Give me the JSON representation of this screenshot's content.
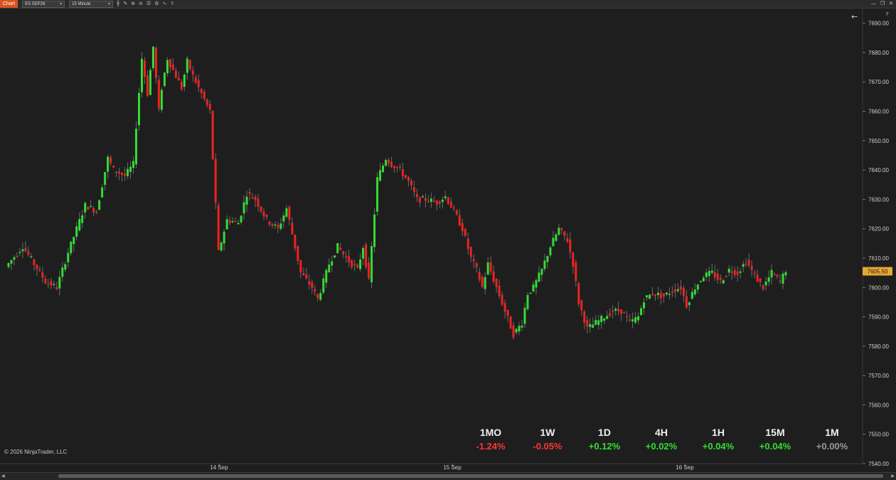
{
  "toolbar": {
    "tab_label": "Chart",
    "instrument": "ES SEP26",
    "interval": "15 Minute",
    "icons": [
      "bar-type-icon",
      "drawing-tools-icon",
      "zoom-in-icon",
      "zoom-out-icon",
      "properties-icon",
      "strategies-icon",
      "indicators-icon",
      "share-icon"
    ],
    "window_controls": [
      "minimize",
      "restore",
      "close"
    ]
  },
  "chart_data": {
    "type": "candlestick",
    "instrument": "ES SEP26",
    "interval": "15 Minute",
    "ylim": [
      7540,
      7695
    ],
    "y_ticks": [
      "7690.00",
      "7680.00",
      "7670.00",
      "7660.00",
      "7650.00",
      "7640.00",
      "7630.00",
      "7620.00",
      "7610.00",
      "7600.00",
      "7590.00",
      "7580.00",
      "7570.00",
      "7560.00",
      "7550.00",
      "7540.00"
    ],
    "x_ticks": [
      "14 Sep",
      "15 Sep",
      "16 Sep"
    ],
    "last_price": "7605.50",
    "colors": {
      "up": "#33dd33",
      "down": "#ee2222",
      "wick": "#6a6a6a",
      "last_price_bg": "#e8a832"
    },
    "close_path": [
      [
        0,
        7607
      ],
      [
        6,
        7614
      ],
      [
        10,
        7608
      ],
      [
        14,
        7602
      ],
      [
        18,
        7600
      ],
      [
        22,
        7612
      ],
      [
        28,
        7628
      ],
      [
        32,
        7626
      ],
      [
        36,
        7644
      ],
      [
        38,
        7640
      ],
      [
        42,
        7638
      ],
      [
        45,
        7642
      ],
      [
        46,
        7655
      ],
      [
        48,
        7678
      ],
      [
        50,
        7666
      ],
      [
        52,
        7682
      ],
      [
        54,
        7660
      ],
      [
        55,
        7668
      ],
      [
        57,
        7678
      ],
      [
        60,
        7672
      ],
      [
        62,
        7668
      ],
      [
        64,
        7677
      ],
      [
        66,
        7672
      ],
      [
        68,
        7668
      ],
      [
        72,
        7660
      ],
      [
        75,
        7612
      ],
      [
        78,
        7623
      ],
      [
        82,
        7622
      ],
      [
        85,
        7632
      ],
      [
        88,
        7630
      ],
      [
        92,
        7623
      ],
      [
        96,
        7620
      ],
      [
        99,
        7627
      ],
      [
        104,
        7605
      ],
      [
        108,
        7600
      ],
      [
        110,
        7596
      ],
      [
        114,
        7608
      ],
      [
        117,
        7614
      ],
      [
        120,
        7610
      ],
      [
        124,
        7606
      ],
      [
        126,
        7614
      ],
      [
        128,
        7602
      ],
      [
        131,
        7637
      ],
      [
        134,
        7644
      ],
      [
        136,
        7642
      ],
      [
        139,
        7640
      ],
      [
        142,
        7636
      ],
      [
        145,
        7630
      ],
      [
        148,
        7630
      ],
      [
        152,
        7629
      ],
      [
        155,
        7631
      ],
      [
        158,
        7626
      ],
      [
        161,
        7620
      ],
      [
        164,
        7610
      ],
      [
        166,
        7606
      ],
      [
        168,
        7600
      ],
      [
        170,
        7608
      ],
      [
        173,
        7600
      ],
      [
        176,
        7592
      ],
      [
        179,
        7584
      ],
      [
        182,
        7588
      ],
      [
        184,
        7598
      ],
      [
        186,
        7600
      ],
      [
        189,
        7606
      ],
      [
        192,
        7614
      ],
      [
        195,
        7620
      ],
      [
        198,
        7616
      ],
      [
        200,
        7608
      ],
      [
        202,
        7595
      ],
      [
        205,
        7586
      ],
      [
        208,
        7588
      ],
      [
        211,
        7590
      ],
      [
        214,
        7592
      ],
      [
        217,
        7592
      ],
      [
        220,
        7588
      ],
      [
        223,
        7590
      ],
      [
        225,
        7596
      ],
      [
        228,
        7598
      ],
      [
        232,
        7597
      ],
      [
        235,
        7599
      ],
      [
        238,
        7600
      ],
      [
        240,
        7594
      ],
      [
        243,
        7600
      ],
      [
        246,
        7604
      ],
      [
        249,
        7605
      ],
      [
        252,
        7602
      ],
      [
        255,
        7606
      ],
      [
        258,
        7605
      ],
      [
        261,
        7609
      ],
      [
        264,
        7604
      ],
      [
        267,
        7600
      ],
      [
        270,
        7605
      ],
      [
        273,
        7602
      ],
      [
        275,
        7606
      ]
    ]
  },
  "performance": [
    {
      "label": "1MO",
      "value": "-1.24%",
      "color": "#ff3333"
    },
    {
      "label": "1W",
      "value": "-0.05%",
      "color": "#ff3333"
    },
    {
      "label": "1D",
      "value": "+0.12%",
      "color": "#33dd33"
    },
    {
      "label": "4H",
      "value": "+0.02%",
      "color": "#33dd33"
    },
    {
      "label": "1H",
      "value": "+0.04%",
      "color": "#33dd33"
    },
    {
      "label": "15M",
      "value": "+0.04%",
      "color": "#33dd33"
    },
    {
      "label": "1M",
      "value": "+0.00%",
      "color": "#9a9a9a"
    }
  ],
  "copyright": "© 2026 NinjaTrader, LLC",
  "controls": {
    "back_arrow": "←",
    "f_label": "F"
  }
}
